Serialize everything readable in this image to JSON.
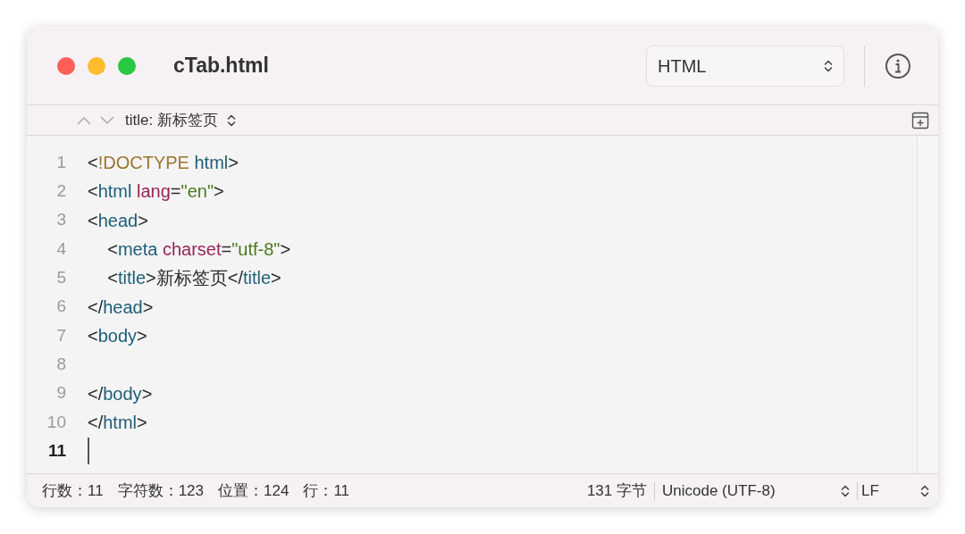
{
  "window": {
    "title": "cTab.html"
  },
  "language_select": {
    "value": "HTML"
  },
  "breadcrumb": {
    "label": "title: 新标签页"
  },
  "editor": {
    "lines": [
      {
        "number": "1",
        "current": false,
        "tokens": [
          {
            "kind": "punct",
            "text": "<"
          },
          {
            "kind": "doctype",
            "text": "!DOCTYPE"
          },
          {
            "kind": "tag",
            "text": " html"
          },
          {
            "kind": "punct",
            "text": ">"
          }
        ]
      },
      {
        "number": "2",
        "current": false,
        "tokens": [
          {
            "kind": "punct",
            "text": "<"
          },
          {
            "kind": "tag",
            "text": "html"
          },
          {
            "kind": "attr",
            "text": " lang"
          },
          {
            "kind": "punct",
            "text": "="
          },
          {
            "kind": "value",
            "text": "\"en\""
          },
          {
            "kind": "punct",
            "text": ">"
          }
        ]
      },
      {
        "number": "3",
        "current": false,
        "tokens": [
          {
            "kind": "punct",
            "text": "<"
          },
          {
            "kind": "tag",
            "text": "head"
          },
          {
            "kind": "punct",
            "text": ">"
          }
        ]
      },
      {
        "number": "4",
        "current": false,
        "tokens": [
          {
            "kind": "punct",
            "text": "    <"
          },
          {
            "kind": "tag",
            "text": "meta"
          },
          {
            "kind": "attr",
            "text": " charset"
          },
          {
            "kind": "punct",
            "text": "="
          },
          {
            "kind": "value",
            "text": "\"utf-8\""
          },
          {
            "kind": "punct",
            "text": ">"
          }
        ]
      },
      {
        "number": "5",
        "current": false,
        "tokens": [
          {
            "kind": "punct",
            "text": "    <"
          },
          {
            "kind": "tag",
            "text": "title"
          },
          {
            "kind": "punct",
            "text": ">"
          },
          {
            "kind": "text",
            "text": "新标签页"
          },
          {
            "kind": "punct",
            "text": "</"
          },
          {
            "kind": "tag",
            "text": "title"
          },
          {
            "kind": "punct",
            "text": ">"
          }
        ]
      },
      {
        "number": "6",
        "current": false,
        "tokens": [
          {
            "kind": "punct",
            "text": "</"
          },
          {
            "kind": "tag",
            "text": "head"
          },
          {
            "kind": "punct",
            "text": ">"
          }
        ]
      },
      {
        "number": "7",
        "current": false,
        "tokens": [
          {
            "kind": "punct",
            "text": "<"
          },
          {
            "kind": "tag",
            "text": "body"
          },
          {
            "kind": "punct",
            "text": ">"
          }
        ]
      },
      {
        "number": "8",
        "current": false
      },
      {
        "number": "9",
        "current": false,
        "tokens": [
          {
            "kind": "punct",
            "text": "</"
          },
          {
            "kind": "tag",
            "text": "body"
          },
          {
            "kind": "punct",
            "text": ">"
          }
        ]
      },
      {
        "number": "10",
        "current": false,
        "tokens": [
          {
            "kind": "punct",
            "text": "</"
          },
          {
            "kind": "tag",
            "text": "html"
          },
          {
            "kind": "punct",
            "text": ">"
          }
        ]
      },
      {
        "number": "11",
        "current": true
      }
    ]
  },
  "status_bar": {
    "stats": [
      "行数：11",
      "字符数：123",
      "位置：124",
      "行：11"
    ],
    "size": "131 字节",
    "encoding_select": {
      "value": "Unicode (UTF-8)"
    },
    "line_ending_select": {
      "value": "LF"
    }
  }
}
